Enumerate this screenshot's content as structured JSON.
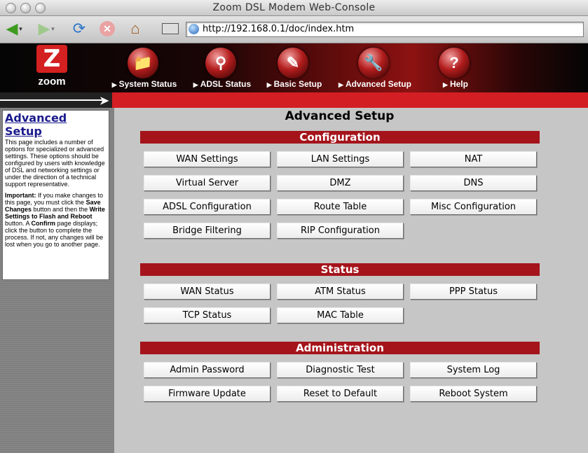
{
  "window": {
    "title": "Zoom DSL Modem Web-Console"
  },
  "browser": {
    "url": "http://192.168.0.1/doc/index.htm"
  },
  "logo": {
    "text": "zoom",
    "mark": "Z"
  },
  "nav": [
    {
      "label": "System Status",
      "icon": "folder-icon"
    },
    {
      "label": "ADSL Status",
      "icon": "magnifier-icon"
    },
    {
      "label": "Basic Setup",
      "icon": "screwdriver-icon"
    },
    {
      "label": "Advanced Setup",
      "icon": "wrench-icon"
    },
    {
      "label": "Help",
      "icon": "question-icon"
    }
  ],
  "sidebar": {
    "title": "Advanced Setup",
    "intro": "This page includes a number of options for specialized or advanced settings. These options should be configured by users with knowledge of DSL and networking settings or under the direction of a technical support representative.",
    "important": {
      "lead": "Important:",
      "t1": " If you make changes to this page, you must click the ",
      "b1": "Save Changes",
      "t2": " button and then the ",
      "b2": "Write Settings to Flash and Reboot",
      "t3": " button. A ",
      "b3": "Confirm",
      "t4": " page displays; click the button to complete the process. If not, any changes will be lost when you go to another page."
    }
  },
  "main": {
    "title": "Advanced Setup",
    "sections": [
      {
        "title": "Configuration",
        "buttons": [
          "WAN Settings",
          "LAN Settings",
          "NAT",
          "Virtual Server",
          "DMZ",
          "DNS",
          "ADSL Configuration",
          "Route Table",
          "Misc Configuration",
          "Bridge Filtering",
          "RIP Configuration"
        ]
      },
      {
        "title": "Status",
        "buttons": [
          "WAN Status",
          "ATM Status",
          "PPP Status",
          "TCP Status",
          "MAC Table"
        ]
      },
      {
        "title": "Administration",
        "buttons": [
          "Admin Password",
          "Diagnostic Test",
          "System Log",
          "Firmware Update",
          "Reset to Default",
          "Reboot System"
        ]
      }
    ]
  },
  "colors": {
    "accent_red": "#a5141b",
    "strip_red": "#d31e23",
    "sidebar_gray": "#7f7f7f",
    "page_bg": "#c6c6c6"
  }
}
